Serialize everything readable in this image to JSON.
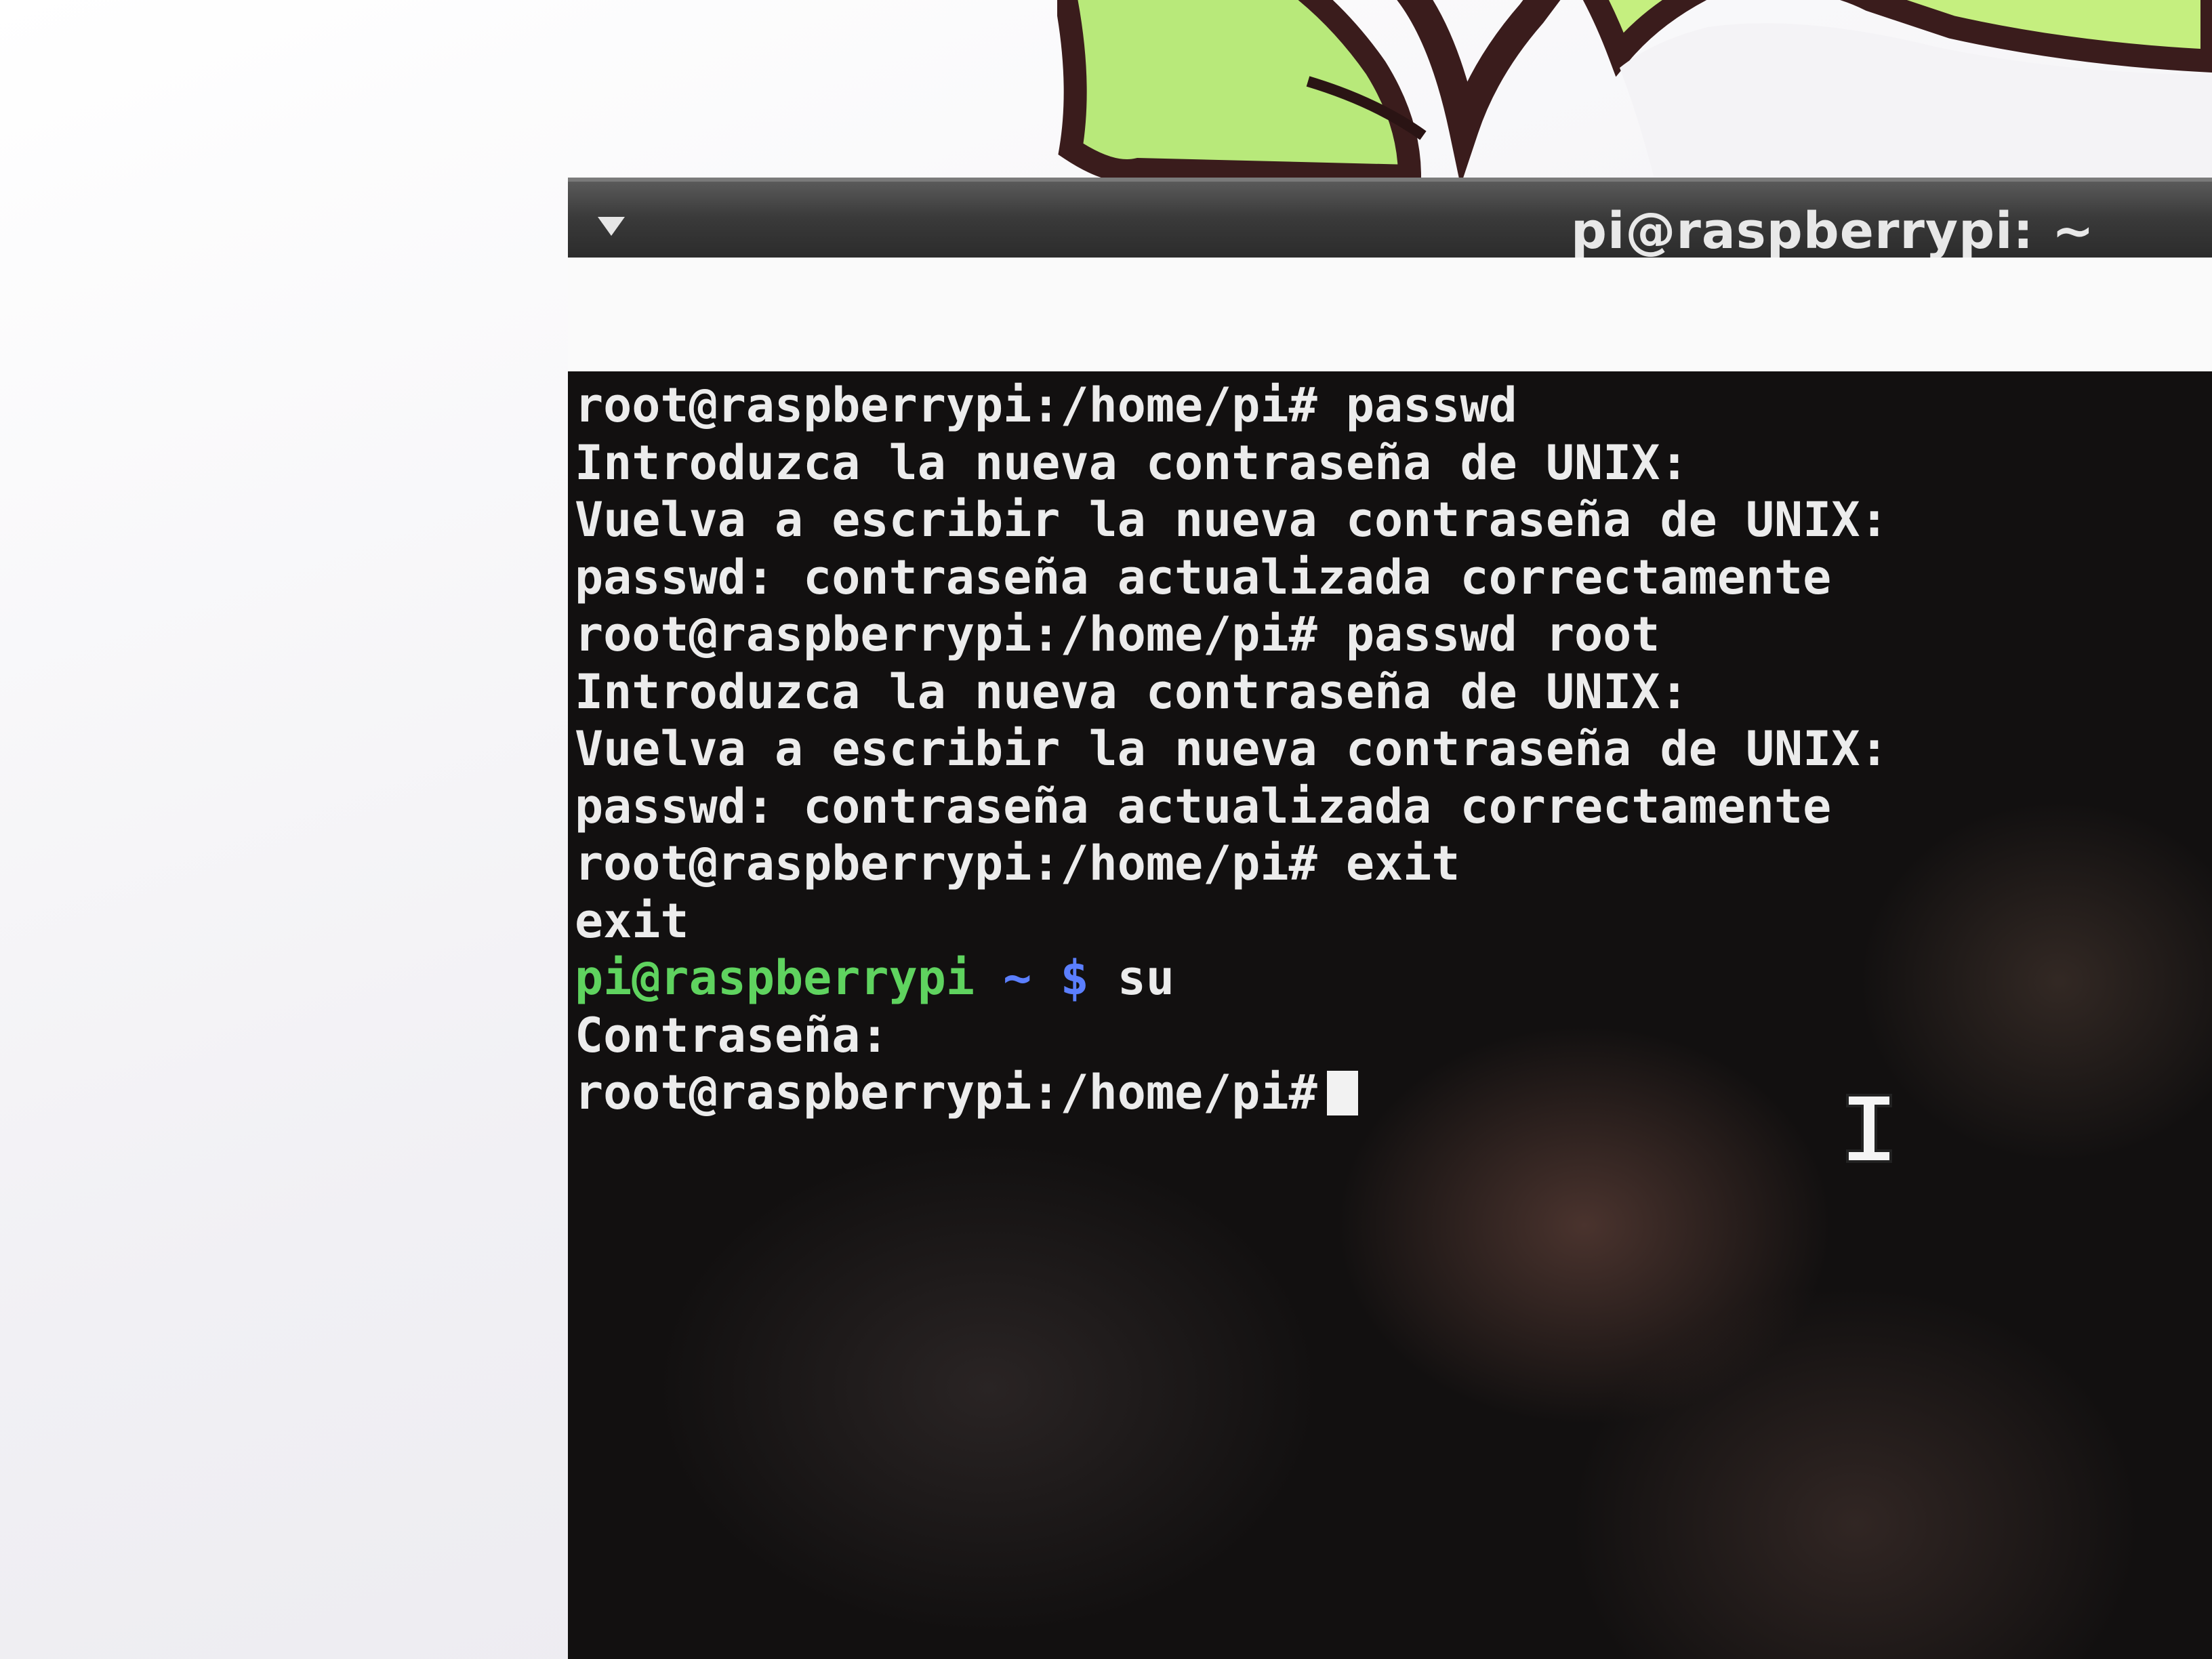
{
  "window": {
    "title": "pi@raspberrypi: ~"
  },
  "terminal": {
    "lines": [
      "root@raspberrypi:/home/pi# passwd",
      "Introduzca la nueva contraseña de UNIX:",
      "Vuelva a escribir la nueva contraseña de UNIX:",
      "passwd: contraseña actualizada correctamente",
      "root@raspberrypi:/home/pi# passwd root",
      "Introduzca la nueva contraseña de UNIX:",
      "Vuelva a escribir la nueva contraseña de UNIX:",
      "passwd: contraseña actualizada correctamente",
      "root@raspberrypi:/home/pi# exit",
      "exit"
    ],
    "user_prompt": {
      "user_host": "pi@raspberrypi",
      "path": " ~ $",
      "command": " su"
    },
    "password_prompt": "Contraseña:",
    "current_prompt": "root@raspberrypi:/home/pi#"
  },
  "colors": {
    "prompt_user": "#5fd35f",
    "prompt_path": "#5b7fff",
    "terminal_text": "#ececec",
    "logo_leaf": "#a8e05a"
  },
  "icons": [
    "raspberry-logo",
    "window-menu-icon",
    "text-cursor-icon"
  ]
}
